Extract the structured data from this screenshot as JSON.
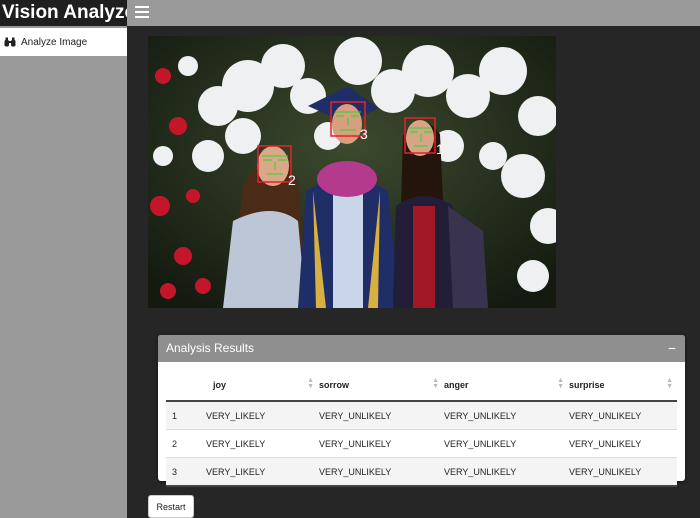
{
  "app": {
    "title": "Vision Analyze"
  },
  "header": {
    "menu_icon": "hamburger-icon"
  },
  "sidebar": {
    "items": [
      {
        "label": "Analyze Image",
        "icon": "binoculars-icon"
      }
    ]
  },
  "image": {
    "face_labels": [
      "1",
      "2",
      "3"
    ],
    "annotation_color": "#e8202a",
    "landmark_color": "#2bd92b"
  },
  "results": {
    "title": "Analysis Results",
    "collapse_icon": "minus-icon",
    "columns": [
      "",
      "joy",
      "sorrow",
      "anger",
      "surprise"
    ],
    "rows": [
      [
        "1",
        "VERY_LIKELY",
        "VERY_UNLIKELY",
        "VERY_UNLIKELY",
        "VERY_UNLIKELY"
      ],
      [
        "2",
        "VERY_LIKELY",
        "VERY_UNLIKELY",
        "VERY_UNLIKELY",
        "VERY_UNLIKELY"
      ],
      [
        "3",
        "VERY_LIKELY",
        "VERY_UNLIKELY",
        "VERY_UNLIKELY",
        "VERY_UNLIKELY"
      ]
    ]
  },
  "restart_label": "Restart"
}
